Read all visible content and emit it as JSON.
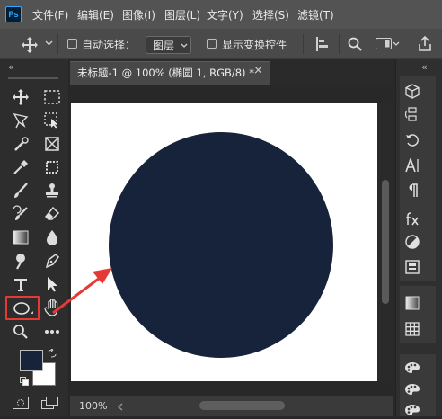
{
  "app": {
    "logo_text": "Ps"
  },
  "menu": [
    "文件(F)",
    "编辑(E)",
    "图像(I)",
    "图层(L)",
    "文字(Y)",
    "选择(S)",
    "滤镜(T)"
  ],
  "options": {
    "auto_select_label": "自动选择：",
    "layer_dropdown_value": "图层",
    "show_transform_label": "显示变换控件"
  },
  "collapse_glyph": "«",
  "document": {
    "tab_title": "未标题-1 @ 100% (椭圆 1, RGB/8) *",
    "tab_close": "×",
    "zoom": "100%",
    "ellipse_color": "#17233b"
  },
  "colors": {
    "foreground": "#17233b",
    "background": "#ffffff",
    "highlight": "#e53935",
    "arrow": "#e53935"
  },
  "left_tools": [
    "move-tool",
    "marquee-tool",
    "lasso-tool",
    "artboard-select-tool",
    "quick-select-tool",
    "frame-tool",
    "eyedropper-tool",
    "crop-tool",
    "brush-tool",
    "stamp-tool",
    "history-brush-tool",
    "eraser-tool",
    "gradient-tool",
    "blur-tool",
    "dodge-tool",
    "pen-tool",
    "type-tool",
    "path-select-tool",
    "ellipse-tool",
    "hand-tool",
    "zoom-tool",
    "more-tools"
  ],
  "right_panel_icons": [
    "3d-cube-icon",
    "history-icon",
    "rotate-icon",
    "character-icon",
    "paragraph-icon",
    "fx-icon",
    "adjustments-icon",
    "properties-icon",
    "gradients-icon",
    "swatches-icon",
    "palette-icon",
    "palette-icon-2",
    "palette-icon-3"
  ]
}
